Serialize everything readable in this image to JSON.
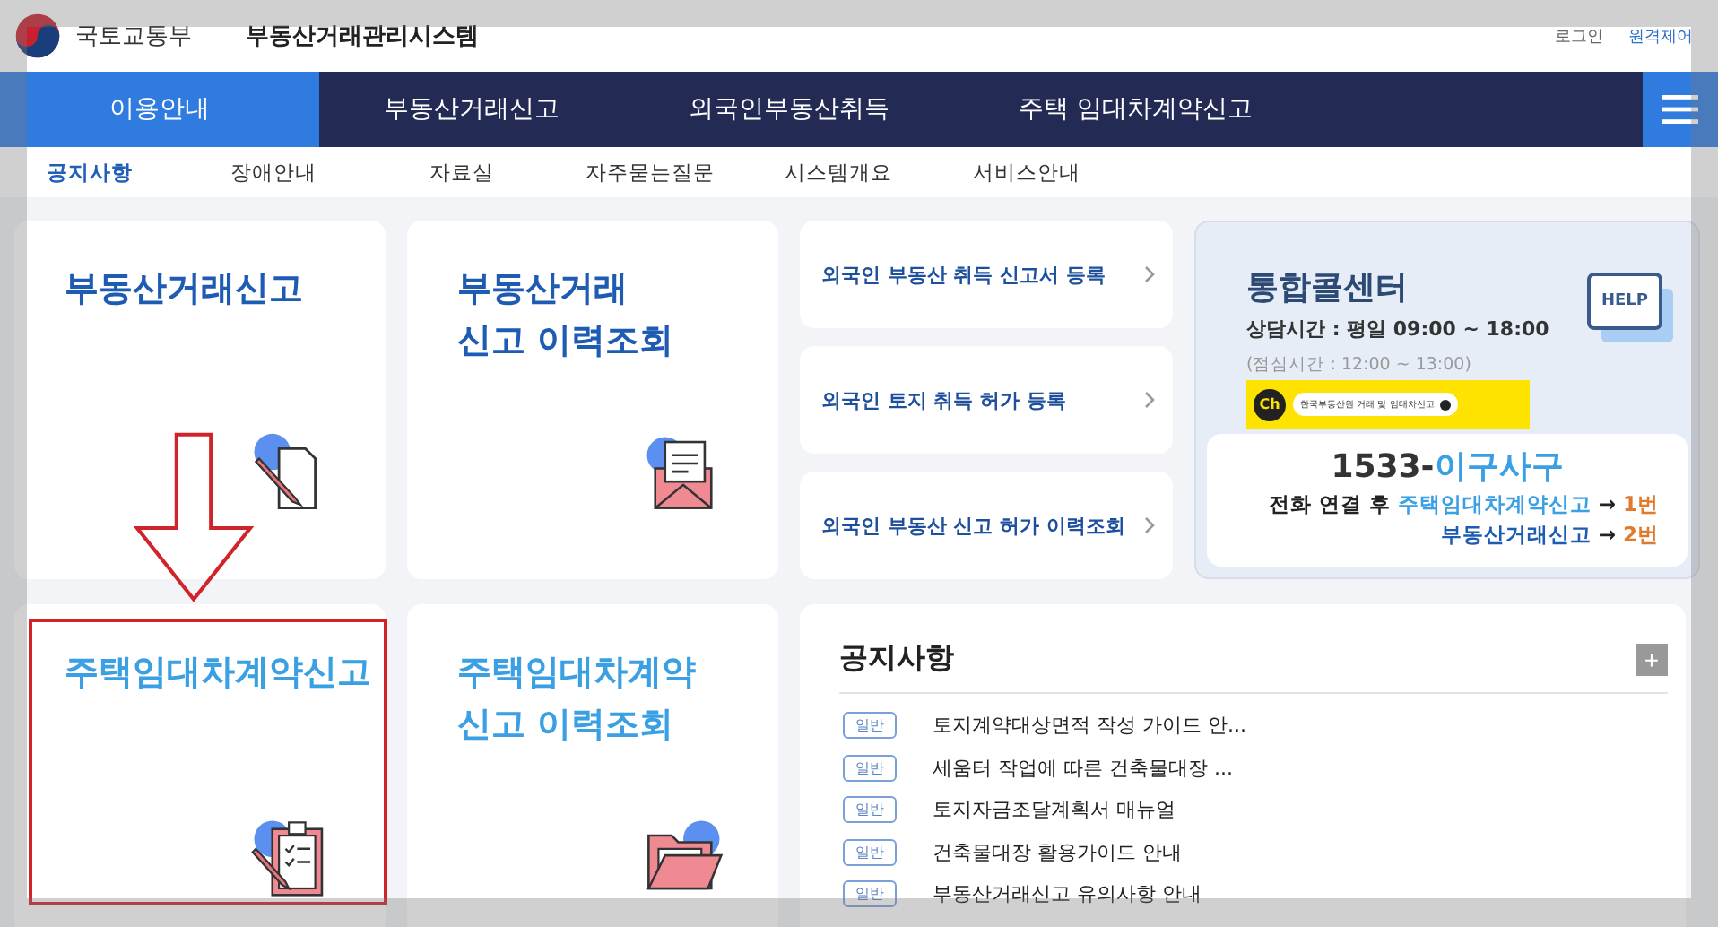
{
  "header": {
    "ministry": "국토교통부",
    "system_title": "부동산거래관리시스템",
    "links": [
      "로그인",
      "원격제어"
    ]
  },
  "nav": {
    "tabs": [
      {
        "label": "이용안내",
        "selected": true
      },
      {
        "label": "부동산거래신고",
        "selected": false
      },
      {
        "label": "외국인부동산취득",
        "selected": false
      },
      {
        "label": "주택 임대차계약신고",
        "selected": false
      }
    ]
  },
  "subnav": [
    {
      "label": "공지사항",
      "selected": true
    },
    {
      "label": "장애안내",
      "selected": false
    },
    {
      "label": "자료실",
      "selected": false
    },
    {
      "label": "자주묻는질문",
      "selected": false
    },
    {
      "label": "시스템개요",
      "selected": false
    },
    {
      "label": "서비스안내",
      "selected": false
    }
  ],
  "tiles": [
    {
      "title": [
        "부동산거래신고"
      ],
      "kind": "doc",
      "highlighted": false
    },
    {
      "title": [
        "부동산거래",
        "신고 이력조회"
      ],
      "kind": "mail",
      "highlighted": false
    },
    {
      "title": [
        "주택임대차계약신고"
      ],
      "kind": "clipboard",
      "highlighted": true
    },
    {
      "title": [
        "주택임대차계약",
        "신고 이력조회"
      ],
      "kind": "folder",
      "highlighted": false
    }
  ],
  "foreign_links": [
    "외국인 부동산 취득 신고서 등록",
    "외국인 토지 취득 허가 등록",
    "외국인 부동산 신고 허가 이력조회"
  ],
  "call_center": {
    "title": "통합콜센터",
    "hours": "상담시간 : 평일 09:00 ~ 18:00",
    "lunch": "(점심시간 : 12:00 ~ 13:00)",
    "chat_badge": "Ch",
    "chat_label": "한국부동산원 거래 및 임대차신고",
    "help_badge": "HELP",
    "phone_number": "1533-",
    "phone_word": "이구사구",
    "lines": [
      {
        "prefix": "전화 연결 후 ",
        "target": "주택임대차계약신고",
        "arrow": " → ",
        "number": "1번"
      },
      {
        "target": "부동산거래신고",
        "arrow": " → ",
        "number": "2번"
      }
    ]
  },
  "notices": {
    "title": "공지사항",
    "more": "+",
    "items": [
      {
        "tag": "일반",
        "text": "토지계약대상면적 작성 가이드 안..."
      },
      {
        "tag": "일반",
        "text": "세움터 작업에 따른 건축물대장 ..."
      },
      {
        "tag": "일반",
        "text": "토지자금조달계획서 매뉴얼"
      },
      {
        "tag": "일반",
        "text": "건축물대장 활용가이드 안내"
      },
      {
        "tag": "일반",
        "text": "부동산거래신고 유의사항 안내"
      }
    ]
  }
}
